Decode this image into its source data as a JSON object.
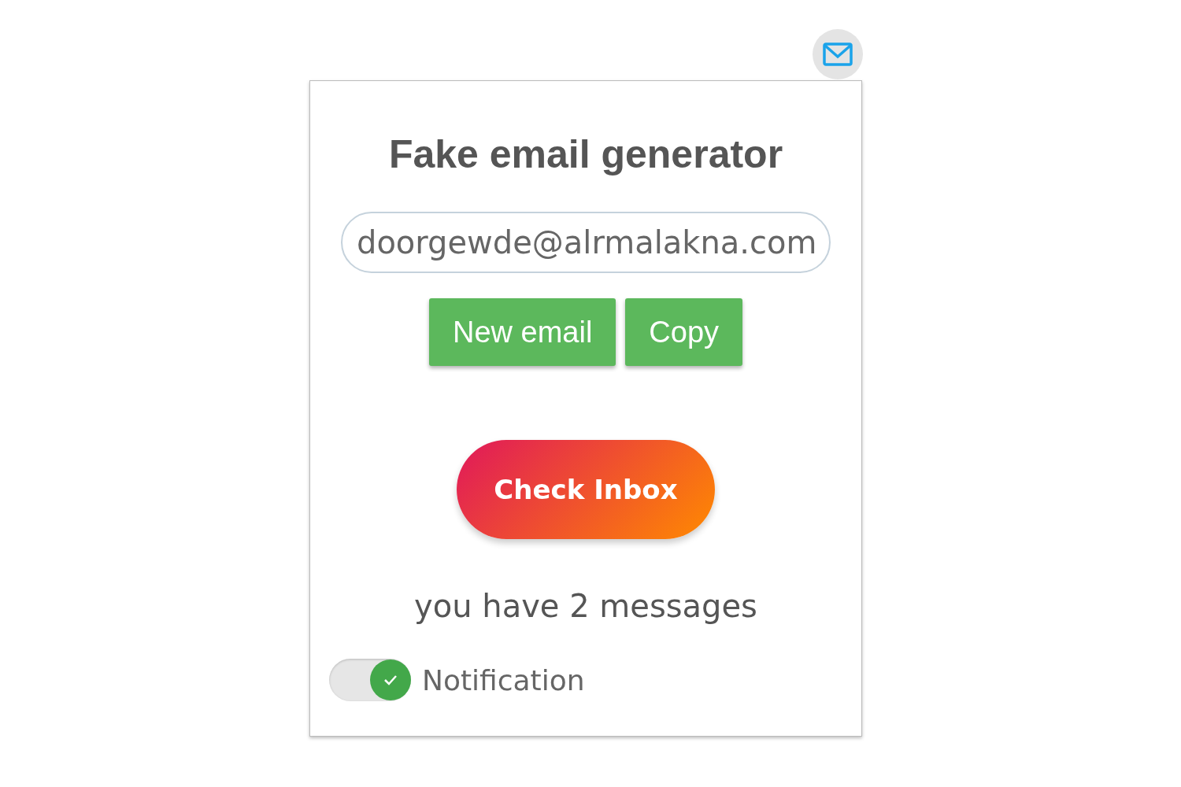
{
  "title": "Fake email generator",
  "email": {
    "value": "doorgewde@alrmalakna.com"
  },
  "buttons": [
    {
      "label": "New email"
    },
    {
      "label": "Copy"
    }
  ],
  "check_inbox": {
    "label": "Check Inbox"
  },
  "message_count": "you have 2 messages",
  "notification": {
    "label": "Notification",
    "on": true
  }
}
